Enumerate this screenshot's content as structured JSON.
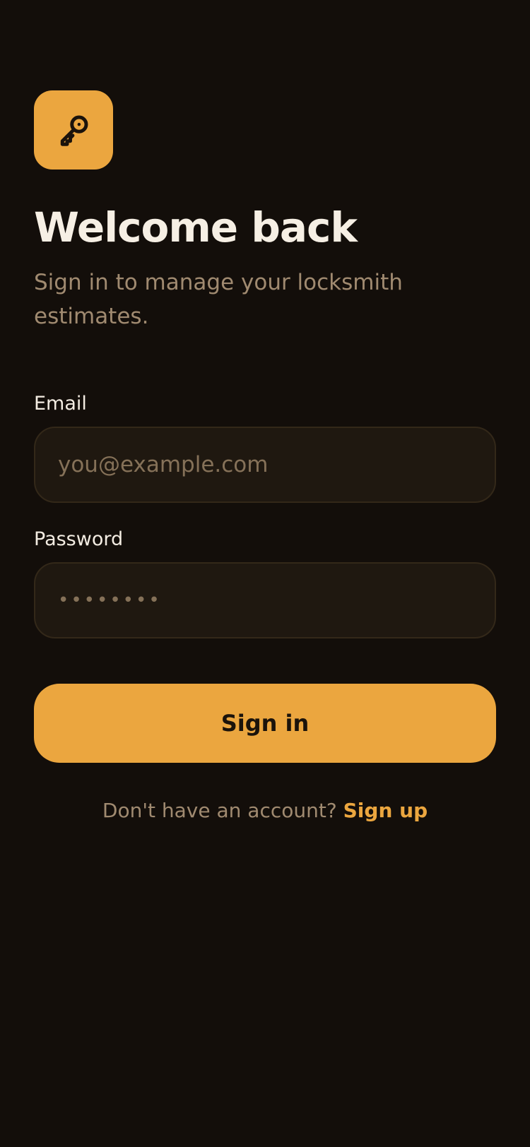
{
  "brand": {
    "icon": "key-icon",
    "accent_color": "#eba63f",
    "background_color": "#130e0a"
  },
  "header": {
    "title": "Welcome back",
    "subtitle": "Sign in to manage your locksmith estimates."
  },
  "form": {
    "email": {
      "label": "Email",
      "placeholder": "you@example.com",
      "value": ""
    },
    "password": {
      "label": "Password",
      "value": "••••••••"
    },
    "submit_label": "Sign in"
  },
  "footer": {
    "prompt": "Don't have an account?",
    "link_label": "Sign up"
  }
}
